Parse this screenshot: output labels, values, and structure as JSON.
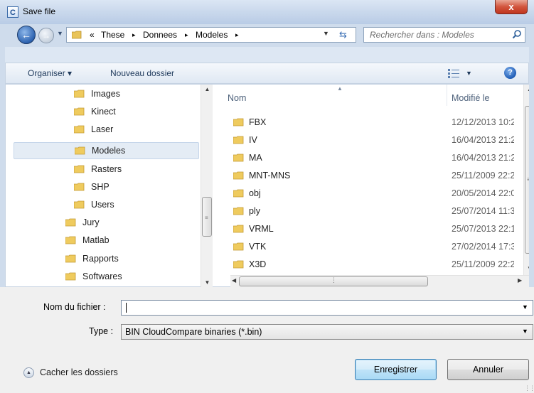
{
  "window": {
    "title": "Save file",
    "app_icon_letter": "C",
    "close_label": "x"
  },
  "address": {
    "crumbs": [
      "«",
      "These",
      "▸",
      "Donnees",
      "▸",
      "Modeles",
      "▸"
    ],
    "search_placeholder": "Rechercher dans : Modeles"
  },
  "toolbar": {
    "organize_label": "Organiser ▾",
    "new_folder_label": "Nouveau dossier",
    "help_label": "?"
  },
  "nav": {
    "items": [
      {
        "label": "Images"
      },
      {
        "label": "Kinect"
      },
      {
        "label": "Laser"
      },
      {
        "label": "Modeles",
        "selected": true
      },
      {
        "label": "Rasters"
      },
      {
        "label": "SHP"
      },
      {
        "label": "Users"
      },
      {
        "label": "Jury"
      },
      {
        "label": "Matlab"
      },
      {
        "label": "Rapports"
      },
      {
        "label": "Softwares"
      }
    ]
  },
  "files": {
    "columns": {
      "name": "Nom",
      "modified": "Modifié le"
    },
    "rows": [
      {
        "name": "FBX",
        "modified": "12/12/2013 10:2"
      },
      {
        "name": "IV",
        "modified": "16/04/2013 21:2"
      },
      {
        "name": "MA",
        "modified": "16/04/2013 21:2"
      },
      {
        "name": "MNT-MNS",
        "modified": "25/11/2009 22:2"
      },
      {
        "name": "obj",
        "modified": "20/05/2014 22:0"
      },
      {
        "name": "ply",
        "modified": "25/07/2014 11:3"
      },
      {
        "name": "VRML",
        "modified": "25/07/2013 22:1"
      },
      {
        "name": "VTK",
        "modified": "27/02/2014 17:3"
      },
      {
        "name": "X3D",
        "modified": "25/11/2009 22:2"
      }
    ]
  },
  "form": {
    "filename_label": "Nom du fichier :",
    "filename_value": "",
    "type_label": "Type :",
    "type_value": "BIN CloudCompare binaries (*.bin)"
  },
  "footer": {
    "hide_folders_label": "Cacher les dossiers",
    "save_label": "Enregistrer",
    "cancel_label": "Annuler"
  }
}
